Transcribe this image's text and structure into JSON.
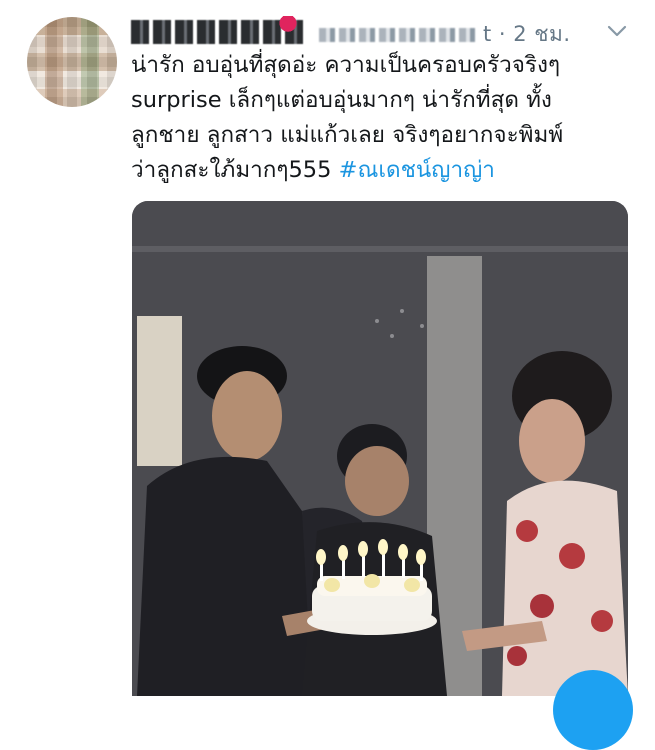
{
  "tweet": {
    "timestamp": "t · 2 ชม.",
    "text_lines": [
      "น่ารัก อบอุ่นที่สุดอ่ะ ความเป็นครอบครัวจริงๆ",
      "surprise เล็กๆแต่อบอุ่นมากๆ  น่ารักที่สุด ทั้ง",
      "ลูกชาย ลูกสาว แม่แก้วเลย จริงๆอยากจะพิมพ์",
      "ว่าลูกสะใภ้มากๆ555 "
    ],
    "hashtag": "#ณเดชน์ญาญ่า"
  },
  "icons": {
    "more": "chevron-down-icon",
    "author_avatar": "avatar",
    "compose": "compose-fab"
  },
  "colors": {
    "hashtag": "#1b95e0",
    "meta": "#657786",
    "fab": "#1da1f2"
  }
}
